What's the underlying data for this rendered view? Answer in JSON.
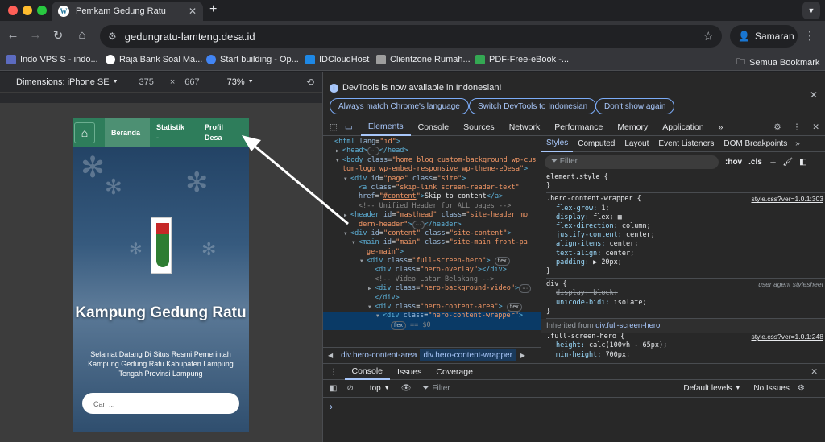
{
  "browser": {
    "tab_title": "Pemkam Gedung Ratu",
    "url": "gedungratu-lamteng.desa.id",
    "profile_name": "Samaran",
    "bookmarks": [
      {
        "label": "Indo VPS S - indo...",
        "color": "#5c6bc0"
      },
      {
        "label": "Raja Bank Soal Ma...",
        "color": "#ffffff"
      },
      {
        "label": "Start building - Op...",
        "color": "#4285f4"
      },
      {
        "label": "IDCloudHost",
        "color": "#1e88e5"
      },
      {
        "label": "Clientzone Rumah...",
        "color": "#9e9e9e"
      },
      {
        "label": "PDF-Free-eBook -...",
        "color": "#34a853"
      }
    ],
    "all_bookmarks": "Semua Bookmark"
  },
  "device_toolbar": {
    "dimensions_label": "Dimensions: iPhone SE",
    "width": "375",
    "times": "×",
    "height": "667",
    "zoom": "73%"
  },
  "site": {
    "nav": [
      "Beranda",
      "Statistik\n-",
      "Profil\nDesa"
    ],
    "hero_title": "Kampung Gedung Ratu",
    "hero_subtitle": "Selamat Datang Di Situs Resmi Pemerintah Kampung Gedung Ratu Kabupaten Lampung Tengah Provinsi Lampung",
    "search_placeholder": "Cari ..."
  },
  "devtools": {
    "info_message": "DevTools is now available in Indonesian!",
    "info_buttons": [
      "Always match Chrome's language",
      "Switch DevTools to Indonesian",
      "Don't show again"
    ],
    "tabs": [
      "Elements",
      "Console",
      "Sources",
      "Network",
      "Performance",
      "Memory",
      "Application"
    ],
    "more_tabs": "»",
    "style_tabs": [
      "Styles",
      "Computed",
      "Layout",
      "Event Listeners",
      "DOM Breakpoints"
    ],
    "filter_placeholder": "Filter",
    "hov": ":hov",
    "cls": ".cls",
    "breadcrumbs": [
      "div.hero-content-area",
      "div.hero-content-wrapper"
    ],
    "console_tabs": [
      "Console",
      "Issues",
      "Coverage"
    ],
    "console_context": "top",
    "console_filter": "Filter",
    "default_levels": "Default levels",
    "no_issues": "No Issues",
    "prompt": "›"
  },
  "dom_lines": [
    {
      "ind": 0,
      "tri": "",
      "html": "<span class='tg'>&lt;html</span> <span class='at'>lang</span>=<span class='av'>\"id\"</span><span class='tg'>&gt;</span>"
    },
    {
      "ind": 1,
      "tri": "▶",
      "html": "<span class='tg'>&lt;head&gt;</span><span class='badge'>···</span><span class='tg'>&lt;/head&gt;</span>"
    },
    {
      "ind": 1,
      "tri": "▼",
      "html": "<span class='tg'>&lt;body</span> <span class='at'>class</span>=<span class='av'>\"home blog custom-background wp-cus</span>"
    },
    {
      "ind": 1,
      "tri": "",
      "html": "<span class='av'>tom-logo wp-embed-responsive wp-theme-eDesa\"</span><span class='tg'>&gt;</span>"
    },
    {
      "ind": 2,
      "tri": "▼",
      "html": "<span class='tg'>&lt;div</span> <span class='at'>id</span>=<span class='av'>\"page\"</span> <span class='at'>class</span>=<span class='av'>\"site\"</span><span class='tg'>&gt;</span>"
    },
    {
      "ind": 3,
      "tri": "",
      "html": "<span class='tg'>&lt;a</span> <span class='at'>class</span>=<span class='av'>\"skip-link screen-reader-text\"</span>"
    },
    {
      "ind": 3,
      "tri": "",
      "html": "<span class='at'>href</span>=<span class='av'>\"<u>#content</u>\"</span><span class='tg'>&gt;</span><span class='tx'>Skip to content</span><span class='tg'>&lt;/a&gt;</span>"
    },
    {
      "ind": 3,
      "tri": "",
      "html": "<span class='cm'>&lt;!-- Unified Header for ALL pages --&gt;</span>"
    },
    {
      "ind": 2,
      "tri": "▶",
      "html": "<span class='tg'>&lt;header</span> <span class='at'>id</span>=<span class='av'>\"masthead\"</span> <span class='at'>class</span>=<span class='av'>\"site-header mo</span>"
    },
    {
      "ind": 3,
      "tri": "",
      "html": "<span class='av'>dern-header\"</span><span class='tg'>&gt;</span><span class='badge'>···</span><span class='tg'>&lt;/header&gt;</span>"
    },
    {
      "ind": 2,
      "tri": "▼",
      "html": "<span class='tg'>&lt;div</span> <span class='at'>id</span>=<span class='av'>\"content\"</span> <span class='at'>class</span>=<span class='av'>\"site-content\"</span><span class='tg'>&gt;</span>"
    },
    {
      "ind": 3,
      "tri": "▼",
      "html": "<span class='tg'>&lt;main</span> <span class='at'>id</span>=<span class='av'>\"main\"</span> <span class='at'>class</span>=<span class='av'>\"site-main front-pa</span>"
    },
    {
      "ind": 4,
      "tri": "",
      "html": "<span class='av'>ge-main\"</span><span class='tg'>&gt;</span>"
    },
    {
      "ind": 4,
      "tri": "▼",
      "html": "<span class='tg'>&lt;div</span> <span class='at'>class</span>=<span class='av'>\"full-screen-hero\"</span><span class='tg'>&gt;</span> <span class='badge'>flex</span>"
    },
    {
      "ind": 5,
      "tri": "",
      "html": "<span class='tg'>&lt;div</span> <span class='at'>class</span>=<span class='av'>\"hero-overlay\"</span><span class='tg'>&gt;&lt;/div&gt;</span>"
    },
    {
      "ind": 5,
      "tri": "",
      "html": "<span class='cm'>&lt;!-- Video Latar Belakang --&gt;</span>"
    },
    {
      "ind": 5,
      "tri": "▶",
      "html": "<span class='tg'>&lt;div</span> <span class='at'>class</span>=<span class='av'>\"hero-background-video\"</span><span class='tg'>&gt;</span><span class='badge'>···</span>"
    },
    {
      "ind": 5,
      "tri": "",
      "html": "<span class='tg'>&lt;/div&gt;</span>"
    },
    {
      "ind": 5,
      "tri": "▼",
      "html": "<span class='tg'>&lt;div</span> <span class='at'>class</span>=<span class='av'>\"hero-content-area\"</span><span class='tg'>&gt;</span> <span class='badge'>flex</span>"
    },
    {
      "ind": 6,
      "tri": "▼",
      "html": "<span class='tg'>&lt;div</span> <span class='at'>class</span>=<span class='av'>\"hero-content-wrapper\"</span><span class='tg'>&gt;</span>",
      "sel": true
    },
    {
      "ind": 7,
      "tri": "",
      "html": "<span class='badge'>flex</span> <span class='cm'>== $0</span>",
      "sel": true
    }
  ],
  "style_rules": [
    {
      "selector": "element.style {",
      "source": "",
      "props": [],
      "close": "}"
    },
    {
      "selector": ".hero-content-wrapper {",
      "source": "style.css?ver=1.0.1:303",
      "props": [
        {
          "p": "flex-grow",
          "v": "1;"
        },
        {
          "p": "display",
          "v": "flex; ▦"
        },
        {
          "p": "flex-direction",
          "v": "column;"
        },
        {
          "p": "justify-content",
          "v": "center;"
        },
        {
          "p": "align-items",
          "v": "center;"
        },
        {
          "p": "text-align",
          "v": "center;"
        },
        {
          "p": "padding",
          "v": "▶ 20px;"
        }
      ],
      "close": "}"
    },
    {
      "selector": "div {",
      "source": "user agent stylesheet",
      "props": [
        {
          "p": "display",
          "v": "block;",
          "strike": true
        },
        {
          "p": "unicode-bidi",
          "v": "isolate;"
        }
      ],
      "close": "}"
    }
  ],
  "inherited_label": "Inherited from",
  "inherited_from": "div.full-screen-hero",
  "inherited_rule": {
    "selector": ".full-screen-hero {",
    "source": "style.css?ver=1.0.1:248",
    "props": [
      {
        "p": "height",
        "v": "calc(100vh - 65px);"
      },
      {
        "p": "min-height",
        "v": "700px;"
      }
    ]
  }
}
